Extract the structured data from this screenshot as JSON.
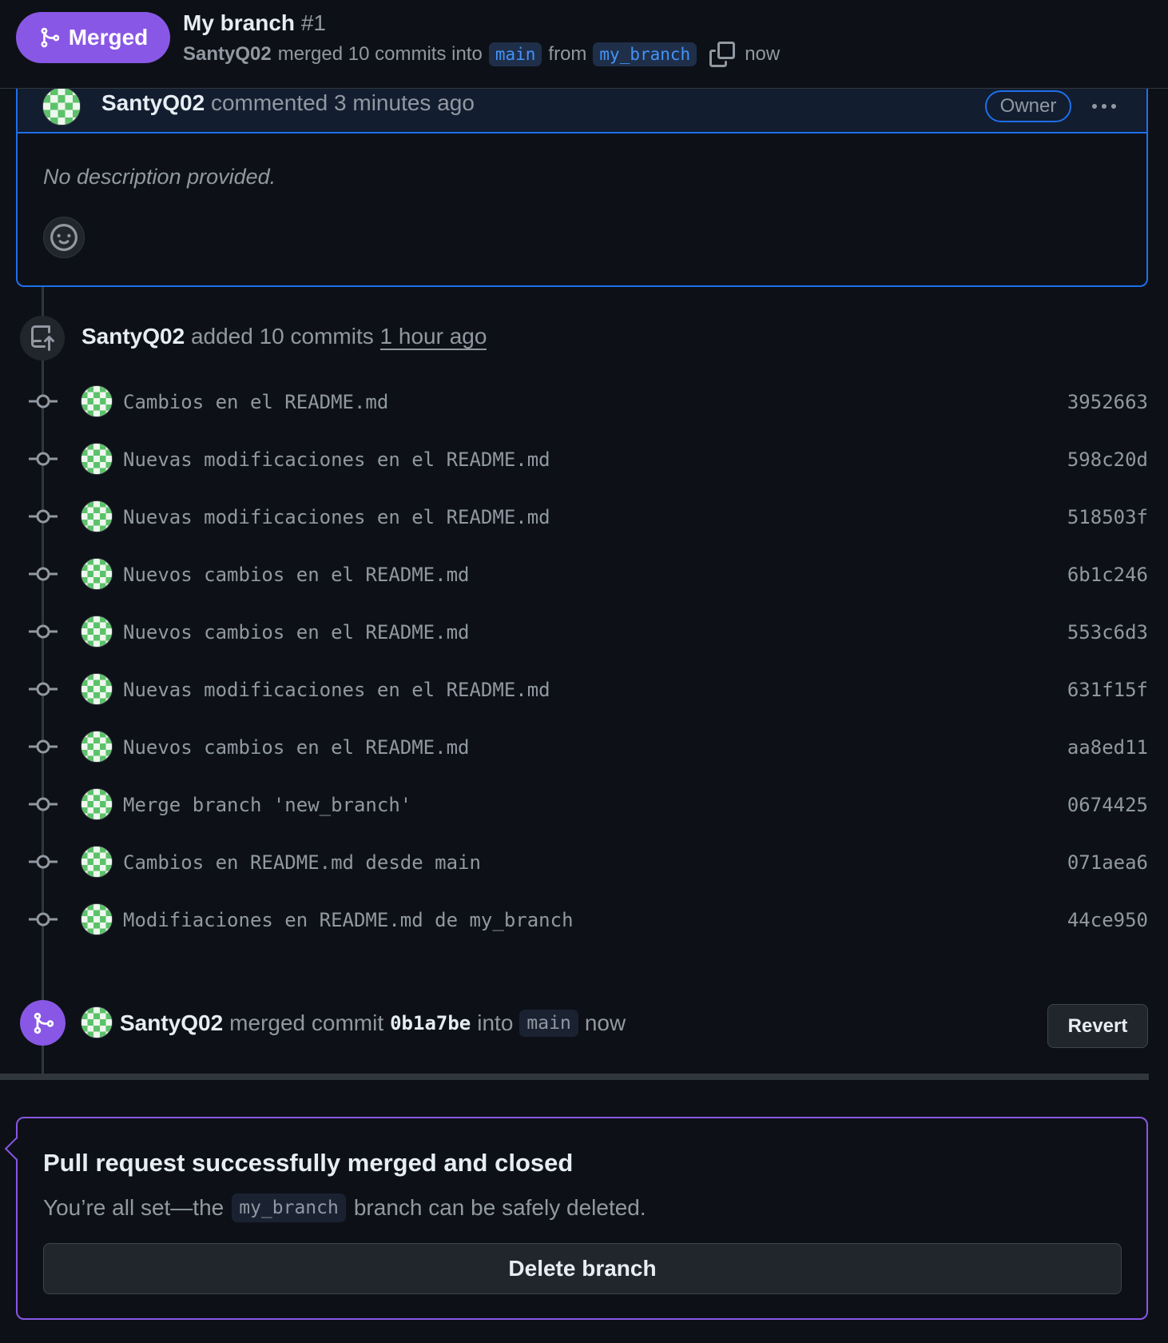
{
  "header": {
    "status_label": "Merged",
    "title": "My branch",
    "number": "#1",
    "author": "SantyQ02",
    "merge_text": "merged 10 commits into",
    "base_branch": "main",
    "from_text": "from",
    "head_branch": "my_branch",
    "time": "now"
  },
  "comment": {
    "author": "SantyQ02",
    "meta": "commented 3 minutes ago",
    "role_badge": "Owner",
    "body": "No description provided."
  },
  "push_event": {
    "author": "SantyQ02",
    "text": "added 10 commits",
    "time": "1 hour ago"
  },
  "commits": [
    {
      "message": "Cambios en el README.md",
      "sha": "3952663"
    },
    {
      "message": "Nuevas modificaciones en el README.md",
      "sha": "598c20d"
    },
    {
      "message": "Nuevas modificaciones en el README.md",
      "sha": "518503f"
    },
    {
      "message": "Nuevos cambios en el README.md",
      "sha": "6b1c246"
    },
    {
      "message": "Nuevos cambios en el README.md",
      "sha": "553c6d3"
    },
    {
      "message": "Nuevas modificaciones en el README.md",
      "sha": "631f15f"
    },
    {
      "message": "Nuevos cambios en el README.md",
      "sha": "aa8ed11"
    },
    {
      "message": "Merge branch 'new_branch'",
      "sha": "0674425"
    },
    {
      "message": "Cambios en README.md desde main",
      "sha": "071aea6"
    },
    {
      "message": "Modifiaciones en README.md de my_branch",
      "sha": "44ce950"
    }
  ],
  "merge_event": {
    "author": "SantyQ02",
    "text": "merged commit",
    "sha": "0b1a7be",
    "into": "into",
    "branch": "main",
    "time": "now",
    "revert_label": "Revert"
  },
  "merged_box": {
    "title": "Pull request successfully merged and closed",
    "desc_before": "You’re all set—the",
    "branch": "my_branch",
    "desc_after": "branch can be safely deleted.",
    "delete_label": "Delete branch"
  },
  "colors": {
    "merged_purple": "#8957e5",
    "accent_blue": "#1f6feb",
    "background": "#0d1117"
  },
  "icons": [
    "git-merge-icon",
    "copy-icon",
    "kebab-horizontal-icon",
    "smiley-icon",
    "repo-push-icon",
    "git-commit-icon",
    "identicon-avatar"
  ]
}
